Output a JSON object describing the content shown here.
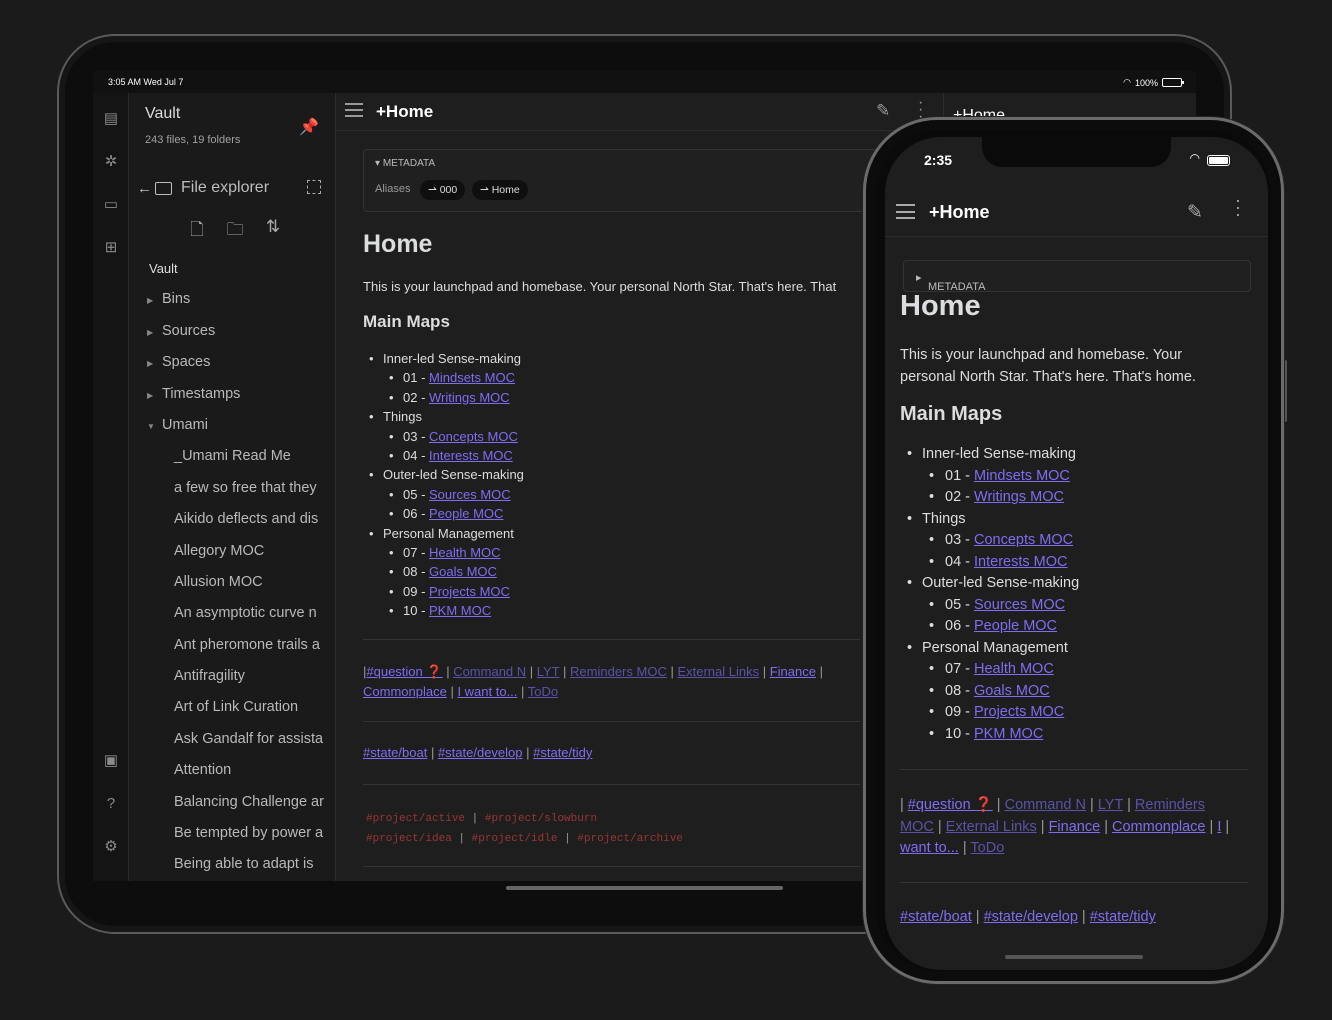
{
  "ipad": {
    "status": {
      "time_date": "3:05 AM   Wed Jul 7",
      "battery": "100%"
    },
    "sidebar": {
      "vault_title": "Vault",
      "vault_stats": "243 files, 19 folders",
      "file_explorer_label": "File explorer",
      "tree": [
        {
          "label": "Vault",
          "type": "root"
        },
        {
          "label": "Bins",
          "type": "folder",
          "expanded": false
        },
        {
          "label": "Sources",
          "type": "folder",
          "expanded": false
        },
        {
          "label": "Spaces",
          "type": "folder",
          "expanded": false
        },
        {
          "label": "Timestamps",
          "type": "folder",
          "expanded": false
        },
        {
          "label": "Umami",
          "type": "folder",
          "expanded": true
        },
        {
          "label": "_Umami Read Me",
          "type": "file"
        },
        {
          "label": "a few so free that they",
          "type": "file"
        },
        {
          "label": "Aikido deflects and dis",
          "type": "file"
        },
        {
          "label": "Allegory MOC",
          "type": "file"
        },
        {
          "label": "Allusion MOC",
          "type": "file"
        },
        {
          "label": "An asymptotic curve n",
          "type": "file"
        },
        {
          "label": "Ant pheromone trails a",
          "type": "file"
        },
        {
          "label": "Antifragility",
          "type": "file"
        },
        {
          "label": "Art of Link Curation",
          "type": "file"
        },
        {
          "label": "Ask Gandalf for assista",
          "type": "file"
        },
        {
          "label": "Attention",
          "type": "file"
        },
        {
          "label": "Balancing Challenge ar",
          "type": "file"
        },
        {
          "label": "Be tempted by power a",
          "type": "file"
        },
        {
          "label": "Being able to adapt is",
          "type": "file"
        }
      ]
    },
    "header": {
      "title": "+Home",
      "right_pane_title": "+Home"
    },
    "metadata": {
      "label": "METADATA",
      "aliases_label": "Aliases",
      "aliases": [
        "000",
        "Home"
      ]
    },
    "intro": "This is your launchpad and homebase. Your personal North Star. That's here. That"
  },
  "doc": {
    "title": "Home",
    "intro": "This is your launchpad and homebase. Your personal North Star. That's here. That's home.",
    "main_maps_heading": "Main Maps",
    "maps": [
      {
        "label": "Inner-led Sense-making",
        "items": [
          {
            "num": "01 - ",
            "link": "Mindsets MOC"
          },
          {
            "num": "02 - ",
            "link": "Writings MOC"
          }
        ]
      },
      {
        "label": "Things",
        "items": [
          {
            "num": "03 - ",
            "link": "Concepts MOC"
          },
          {
            "num": "04 - ",
            "link": "Interests MOC"
          }
        ]
      },
      {
        "label": "Outer-led Sense-making",
        "items": [
          {
            "num": "05 - ",
            "link": "Sources MOC"
          },
          {
            "num": "06 - ",
            "link": "People MOC"
          }
        ]
      },
      {
        "label": "Personal Management",
        "items": [
          {
            "num": "07 - ",
            "link": "Health MOC"
          },
          {
            "num": "08 - ",
            "link": "Goals MOC"
          },
          {
            "num": "09 - ",
            "link": "Projects MOC"
          },
          {
            "num": "10 - ",
            "link": "PKM MOC"
          }
        ]
      }
    ],
    "quick_links": [
      {
        "label": "#question ❓",
        "dim": false
      },
      {
        "label": "Command N",
        "dim": true
      },
      {
        "label": "LYT",
        "dim": true
      },
      {
        "label": "Reminders MOC",
        "dim": true
      },
      {
        "label": "External Links",
        "dim": true
      },
      {
        "label": "Finance",
        "dim": false
      },
      {
        "label": "Commonplace",
        "dim": false
      },
      {
        "label": "I want to...",
        "dim": false
      },
      {
        "label": "ToDo",
        "dim": true
      }
    ],
    "states": [
      "#state/boat",
      "#state/develop",
      "#state/tidy"
    ],
    "projects": [
      "#project/active",
      "#project/slowburn",
      "#project/idea",
      "#project/idle",
      "#project/archive"
    ]
  },
  "iphone": {
    "time": "2:35",
    "header_title": "+Home",
    "metadata_label": "METADATA",
    "intro_line1": "This is your launchpad and homebase. Your",
    "intro_line2": "personal North Star. That's here. That's home.",
    "quick_lines": [
      [
        "#question ❓",
        "Command N",
        "LYT",
        "Reminders"
      ],
      [
        "MOC",
        "External Links",
        "Finance",
        "Commonplace",
        "I"
      ],
      [
        "want to...",
        "ToDo"
      ]
    ]
  },
  "colors": {
    "link": "#7f6df2",
    "link_dim": "#5a53a8",
    "tag_project": "#9a3535",
    "bg": "#1e1e1e"
  }
}
